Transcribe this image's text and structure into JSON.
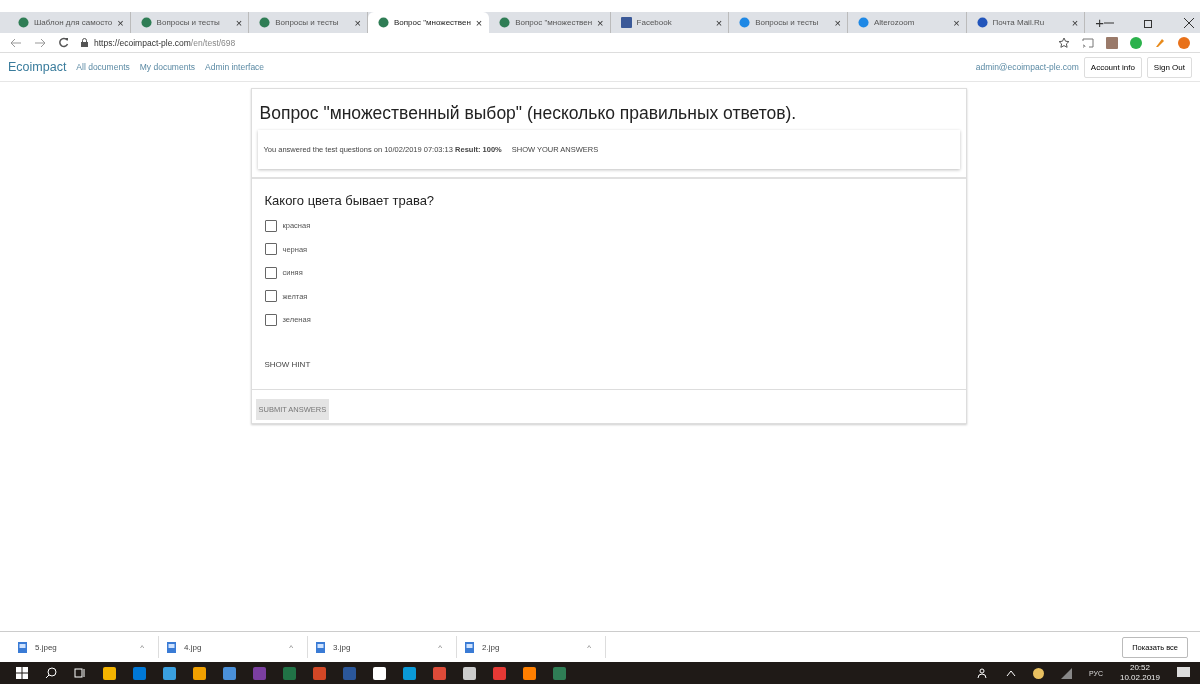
{
  "browser": {
    "tabs": [
      {
        "label": "Шаблон для самосто",
        "kind": "globe",
        "selected": false
      },
      {
        "label": "Вопросы и тесты",
        "kind": "globe",
        "selected": false
      },
      {
        "label": "Вопросы и тесты",
        "kind": "globe",
        "selected": false
      },
      {
        "label": "Вопрос \"множествен",
        "kind": "globe",
        "selected": true
      },
      {
        "label": "Вопрос \"множествен",
        "kind": "globe",
        "selected": false
      },
      {
        "label": "Facebook",
        "kind": "facebook",
        "selected": false
      },
      {
        "label": "Вопросы и тесты",
        "kind": "altero",
        "selected": false
      },
      {
        "label": "Alterozoom",
        "kind": "altero",
        "selected": false
      },
      {
        "label": "Почта Mail.Ru",
        "kind": "mail",
        "selected": false
      }
    ],
    "close_glyph": "×",
    "new_tab": "+",
    "url_host": "https://ecoimpact-ple.com",
    "url_path": "/en/test/698"
  },
  "nav": {
    "brand": "Ecoimpact",
    "links": [
      "All documents",
      "My documents",
      "Admin interface"
    ],
    "email": "admin@ecoimpact-ple.com",
    "buttons": [
      "Account info",
      "Sign Out"
    ]
  },
  "test": {
    "title": "Вопрос \"множественный выбор\" (несколько правильных ответов).",
    "result": {
      "text": "You answered the test questions on 10/02/2019 07:03:13 **Result: 100%**",
      "action": "SHOW YOUR ANSWERS"
    },
    "question": "Какого цвета бывает трава?",
    "options": [
      {
        "label": "красная",
        "checked": false
      },
      {
        "label": "черная",
        "checked": false
      },
      {
        "label": "синяя",
        "checked": false
      },
      {
        "label": "желтая",
        "checked": false
      },
      {
        "label": "зеленая",
        "checked": false
      }
    ],
    "hint": "SHOW HINT",
    "submit": {
      "label": "SUBMIT ANSWERS",
      "disabled": true
    }
  },
  "downloads": {
    "items": [
      "5.jpeg",
      "4.jpg",
      "3.jpg",
      "2.jpg"
    ],
    "caret": "^",
    "show_all": "Показать все"
  },
  "taskbar": {
    "lang": "РУС",
    "time": "20:52",
    "date": "10.02.2019"
  }
}
